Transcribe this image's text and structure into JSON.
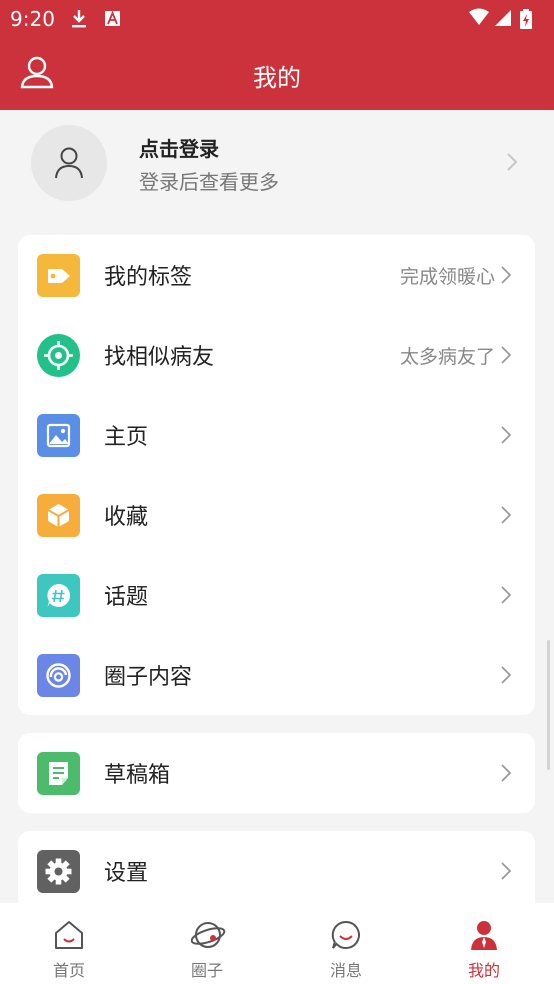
{
  "status_bar": {
    "time": "9:20"
  },
  "header": {
    "title": "我的"
  },
  "login": {
    "title": "点击登录",
    "subtitle": "登录后查看更多"
  },
  "menu_group_1": [
    {
      "label": "我的标签",
      "right_text": "完成领暖心",
      "icon": "tag-icon",
      "color": "#f5b83a"
    },
    {
      "label": "找相似病友",
      "right_text": "太多病友了",
      "icon": "target-icon",
      "color": "#22c18a"
    },
    {
      "label": "主页",
      "right_text": "",
      "icon": "image-icon",
      "color": "#5b8ee6"
    },
    {
      "label": "收藏",
      "right_text": "",
      "icon": "box-icon",
      "color": "#f7ad3b"
    },
    {
      "label": "话题",
      "right_text": "",
      "icon": "hashtag-chat-icon",
      "color": "#3ec6c0"
    },
    {
      "label": "圈子内容",
      "right_text": "",
      "icon": "circle-swirl-icon",
      "color": "#6b86e6"
    }
  ],
  "menu_group_2": [
    {
      "label": "草稿箱",
      "right_text": "",
      "icon": "document-icon",
      "color": "#4cbb6c"
    }
  ],
  "menu_group_3": [
    {
      "label": "设置",
      "right_text": "",
      "icon": "gear-icon",
      "color": "#616161"
    }
  ],
  "tabbar": {
    "active_color": "#cc323b",
    "items": [
      {
        "label": "首页",
        "icon": "home-icon"
      },
      {
        "label": "圈子",
        "icon": "planet-icon"
      },
      {
        "label": "消息",
        "icon": "chat-smile-icon"
      },
      {
        "label": "我的",
        "icon": "person-icon"
      }
    ]
  }
}
